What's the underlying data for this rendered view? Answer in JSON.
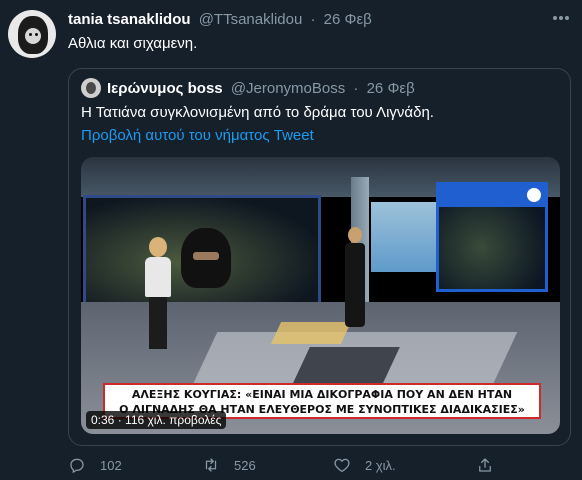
{
  "tweet": {
    "author_name": "tania tsanaklidou",
    "author_handle": "@TTsanaklidou",
    "separator": "·",
    "date": "26 Φεβ",
    "text": "Αθλια και σιχαμενη.",
    "more_icon": "more-icon"
  },
  "quoted": {
    "author_name": "Ιερώνυμος boss",
    "author_handle": "@JeronymoBoss",
    "separator": "·",
    "date": "26 Φεβ",
    "text": "Η Τατιάνα συγκλονισμένη από το δράμα του Λιγνάδη.",
    "link_text": "Προβολή αυτού του νήματος Tweet",
    "video": {
      "ticker_line1": "ΑΛΕΞΗΣ ΚΟΥΓΙΑΣ: «ΕΙΝΑΙ ΜΙΑ ΔΙΚΟΓΡΑΦΙΑ ΠΟΥ ΑΝ ΔΕΝ ΗΤΑΝ",
      "ticker_line2": "Ο ΛΙΓΝΑΔΗΣ ΘΑ ΗΤΑΝ ΕΛΕΥΘΕΡΟΣ ΜΕ ΣΥΝΟΠΤΙΚΕΣ ΔΙΑΔΙΚΑΣΙΕΣ»",
      "duration": "0:36",
      "views_separator": "·",
      "views": "116 χιλ. προβολές"
    }
  },
  "actions": {
    "replies": "102",
    "retweets": "526",
    "likes": "2 χιλ."
  },
  "colors": {
    "background": "#15202b",
    "secondary_text": "#8899a6",
    "link": "#1d9bf0",
    "border": "#38444d"
  }
}
